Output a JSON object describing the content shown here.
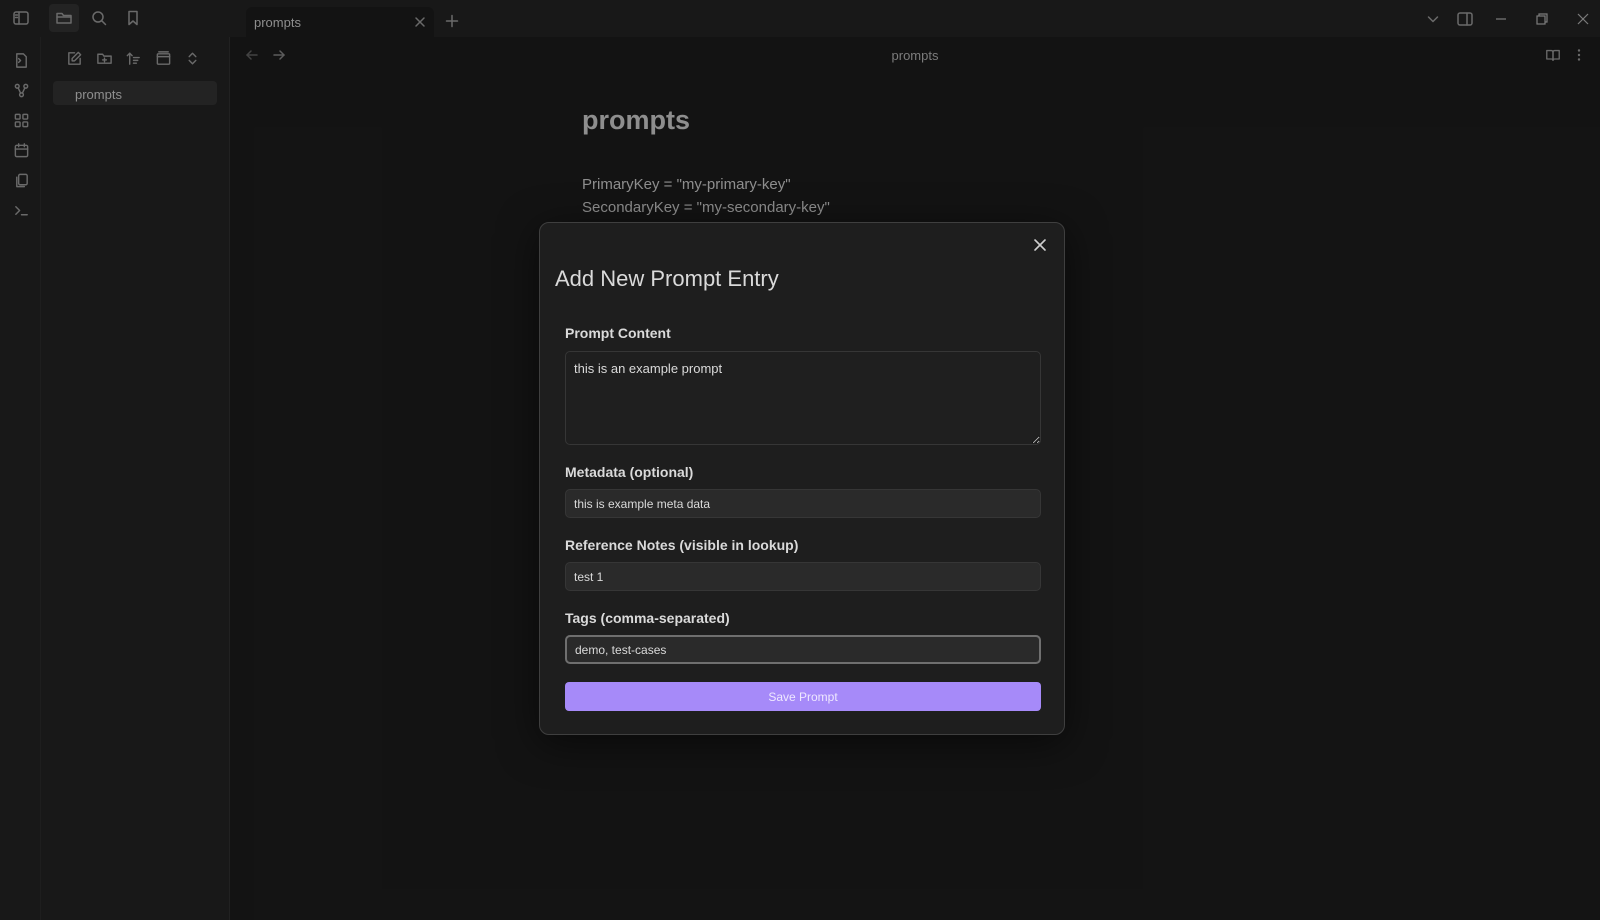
{
  "tab": {
    "label": "prompts"
  },
  "file_explorer": {
    "items": [
      {
        "label": "prompts"
      }
    ]
  },
  "view": {
    "title": "prompts"
  },
  "note": {
    "title": "prompts",
    "lines": [
      "PrimaryKey = \"my-primary-key\"",
      "SecondaryKey = \"my-secondary-key\""
    ]
  },
  "modal": {
    "title": "Add New Prompt Entry",
    "prompt_content_label": "Prompt Content",
    "prompt_content_value": "this is an example prompt",
    "metadata_label": "Metadata (optional)",
    "metadata_value": "this is example meta data",
    "reference_label": "Reference Notes (visible in lookup)",
    "reference_value": "test 1",
    "tags_label": "Tags (comma-separated)",
    "tags_value": "demo, test-cases",
    "save_label": "Save Prompt"
  },
  "colors": {
    "accent": "#a68af9",
    "background": "#1e1e1e",
    "panel": "#262626"
  }
}
